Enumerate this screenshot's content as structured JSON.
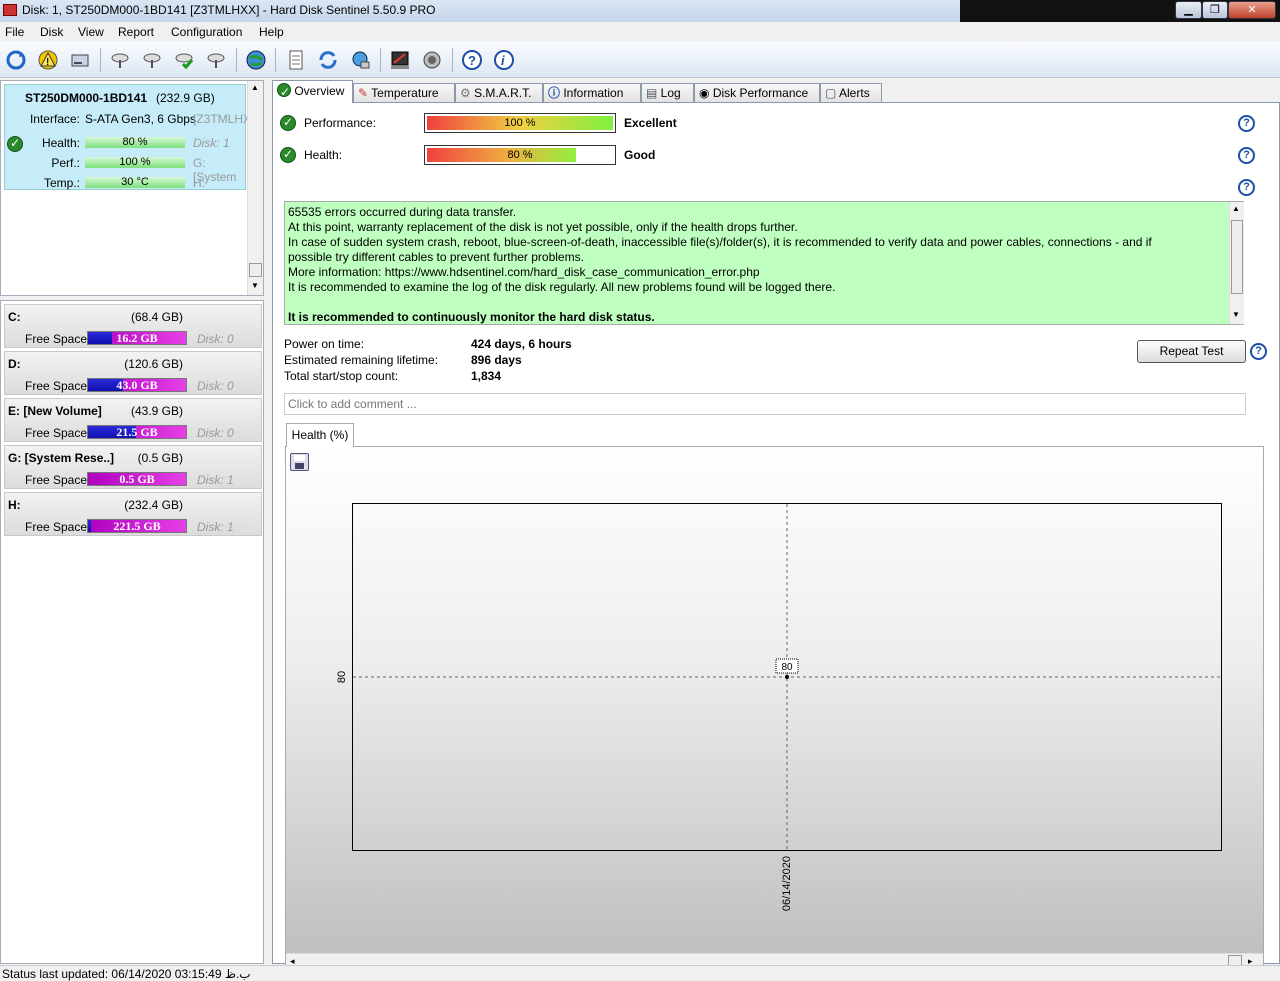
{
  "window": {
    "title": "Disk: 1, ST250DM000-1BD141 [Z3TMLHXX]  -  Hard Disk Sentinel 5.50.9 PRO"
  },
  "menu": [
    "File",
    "Disk",
    "View",
    "Report",
    "Configuration",
    "Help"
  ],
  "toolbar": [
    "refresh-icon",
    "alert-icon",
    "disk-icon",
    "disk-settings-icon",
    "disk-settings-2-icon",
    "disk-check-icon",
    "disk-remove-icon",
    "web-icon",
    "report-icon",
    "update-icon",
    "network-icon",
    "benchmark-icon",
    "sound-icon",
    "help-icon",
    "info-icon"
  ],
  "disk": {
    "name": "ST250DM000-1BD141",
    "size": "(232.9 GB)",
    "interface_label": "Interface:",
    "interface_value": "S-ATA Gen3, 6 Gbps",
    "serial": "[Z3TMLHXX]",
    "health_label": "Health:",
    "health_value": "80 %",
    "health_pct": 80,
    "perf_label": "Perf.:",
    "perf_value": "100 %",
    "perf_pct": 100,
    "temp_label": "Temp.:",
    "temp_value": "30 °C",
    "side1": "Disk: 1",
    "side2": "G: [System",
    "side3": "H:"
  },
  "volumes": [
    {
      "name": "C:",
      "size": "(68.4 GB)",
      "free_label": "Free Space",
      "free": "16.2 GB",
      "free_frac": 0.24,
      "disk": "Disk: 0"
    },
    {
      "name": "D:",
      "size": "(120.6 GB)",
      "free_label": "Free Space",
      "free": "43.0 GB",
      "free_frac": 0.36,
      "disk": "Disk: 0"
    },
    {
      "name": "E: [New Volume]",
      "size": "(43.9 GB)",
      "free_label": "Free Space",
      "free": "21.5 GB",
      "free_frac": 0.49,
      "disk": "Disk: 0"
    },
    {
      "name": "G: [System Rese..]",
      "size": "(0.5 GB)",
      "free_label": "Free Space",
      "free": "0.5 GB",
      "free_frac": 0.0,
      "disk": "Disk: 1"
    },
    {
      "name": "H:",
      "size": "(232.4 GB)",
      "free_label": "Free Space",
      "free": "221.5 GB",
      "free_frac": 0.03,
      "disk": "Disk: 1"
    }
  ],
  "tabs": [
    {
      "label": "Overview",
      "icon": "check-icon"
    },
    {
      "label": "Temperature",
      "icon": "thermometer-icon"
    },
    {
      "label": "S.M.A.R.T.",
      "icon": "smart-icon"
    },
    {
      "label": "Information",
      "icon": "info-icon"
    },
    {
      "label": "Log",
      "icon": "log-icon"
    },
    {
      "label": "Disk Performance",
      "icon": "performance-icon"
    },
    {
      "label": "Alerts",
      "icon": "alerts-icon"
    }
  ],
  "overview": {
    "performance_label": "Performance:",
    "performance_value": "100 %",
    "performance_pct": 100,
    "performance_rating": "Excellent",
    "health_label": "Health:",
    "health_value": "80 %",
    "health_pct": 80,
    "health_rating": "Good",
    "message_lines": [
      "65535 errors occurred during data transfer.",
      "At this point, warranty replacement of the disk is not yet possible, only if the health drops further.",
      "In case of sudden system crash, reboot, blue-screen-of-death, inaccessible file(s)/folder(s), it is recommended to verify data and power cables, connections - and if",
      "possible try different cables to prevent further problems.",
      "More information: https://www.hdsentinel.com/hard_disk_case_communication_error.php",
      "It is recommended to examine the log of the disk regularly. All new problems found will be logged there.",
      "",
      "It is recommended to continuously monitor the hard disk status."
    ],
    "power_on_label": "Power on time:",
    "power_on_value": "424 days, 6 hours",
    "lifetime_label": "Estimated remaining lifetime:",
    "lifetime_value": "896 days",
    "startstop_label": "Total start/stop count:",
    "startstop_value": "1,834",
    "repeat_test": "Repeat Test",
    "comment_placeholder": "Click to add comment ...",
    "chart_tab": "Health (%)"
  },
  "chart_data": {
    "type": "line",
    "x": [
      "06/14/2020"
    ],
    "series": [
      {
        "values": [
          80
        ]
      }
    ],
    "y_tick_labels": [
      "80"
    ],
    "x_tick_labels": [
      "06/14/2020"
    ],
    "data_labels": [
      "80"
    ],
    "grid": true
  },
  "status": {
    "text": "Status last updated: 06/14/2020 03:15:49 ب.ظ"
  },
  "colors": {
    "disk_card": "#c6ecf9",
    "message_bg": "#bfffbf",
    "volume_free": "#1010b0",
    "volume_used": "#d020d0"
  }
}
